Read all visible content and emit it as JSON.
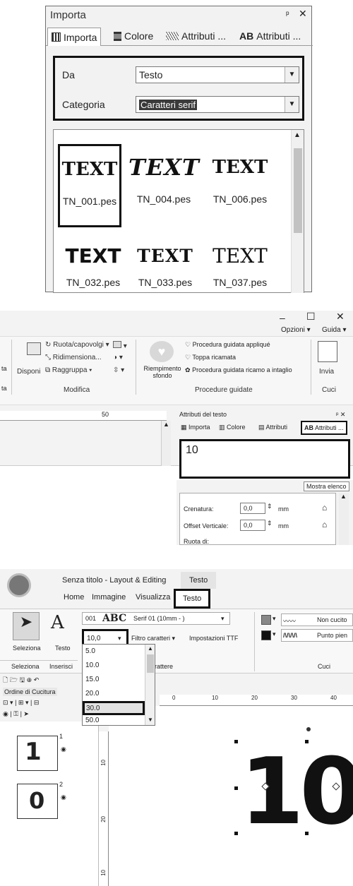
{
  "panel1": {
    "title": "Importa",
    "pin": "ᵖ",
    "close": "✕",
    "tabs": [
      "Importa",
      "Colore",
      "Attributi ...",
      "Attributi ..."
    ],
    "tab_ab_prefix": "AB",
    "da_label": "Da",
    "da_value": "Testo",
    "categoria_label": "Categoria",
    "categoria_value": "Caratteri serif",
    "thumbs": [
      {
        "text": "TEXT",
        "label": "TN_001.pes"
      },
      {
        "text": "TEXT",
        "label": "TN_004.pes"
      },
      {
        "text": "TEXT",
        "label": "TN_006.pes"
      },
      {
        "text": "TEXT",
        "label": "TN_032.pes"
      },
      {
        "text": "TEXT",
        "label": "TN_033.pes"
      },
      {
        "text": "TEXT",
        "label": "TN_037.pes"
      }
    ]
  },
  "panel2": {
    "win_min": "–",
    "win_max": "☐",
    "win_close": "✕",
    "opzioni": "Opzioni",
    "guida": "Guida",
    "ruota": "Ruota/capovolgi",
    "ridimensiona": "Ridimensiona...",
    "raggruppa": "Raggruppa",
    "disponi": "Disponi",
    "modifica": "Modifica",
    "riempimento": "Riempimento sfondo",
    "proc_applique": "Procedura guidata appliqué",
    "toppa": "Toppa ricamata",
    "proc_intaglio": "Procedura guidata ricamo a intaglio",
    "procedure_guidate": "Procedure guidate",
    "invia": "Invia",
    "cuci": "Cuci",
    "left_cut1": "ta",
    "left_cut2": "ta",
    "ruler_50": "50",
    "attr_title": "Attributi del testo",
    "attr_tabs": [
      "Importa",
      "Colore",
      "Attributi",
      "Attributi ..."
    ],
    "attr_ab": "AB",
    "text_value": "10",
    "mostra": "Mostra elenco",
    "crenatura": "Crenatura:",
    "crenatura_val": "0,0",
    "offset": "Offset Verticale:",
    "offset_val": "0,0",
    "mm": "mm",
    "ruota_di": "Ruota di:"
  },
  "panel3": {
    "title": "Senza titolo - Layout & Editing",
    "context_tab": "Testo",
    "tabs": [
      "Home",
      "Immagine",
      "Visualizza",
      "Testo"
    ],
    "seleziona": "Seleziona",
    "testo": "Testo",
    "seleziona_group": "Seleziona",
    "inserisci_group": "Inserisci",
    "font_num": "001",
    "font_preview": "ABC",
    "font_name": "Serif 01  (10mm - )",
    "size_value": "10,0",
    "filtro": "Filtro caratteri",
    "impostazioni": "Impostazioni TTF",
    "carattere": "arattere",
    "non_cucito": "Non cucito",
    "punto_pieno": "Punto pien",
    "cuci": "Cuci",
    "ordine": "Ordine di Cucitura",
    "size_options": [
      "5.0",
      "10.0",
      "15.0",
      "20.0",
      "30.0",
      "50.0"
    ],
    "ruler_marks": [
      "0",
      "10",
      "20",
      "30",
      "40"
    ],
    "vruler": [
      "10",
      "20",
      "10"
    ],
    "items": [
      {
        "num": "1",
        "glyph": "1"
      },
      {
        "num": "2",
        "glyph": "0"
      }
    ],
    "canvas_text": "10"
  }
}
